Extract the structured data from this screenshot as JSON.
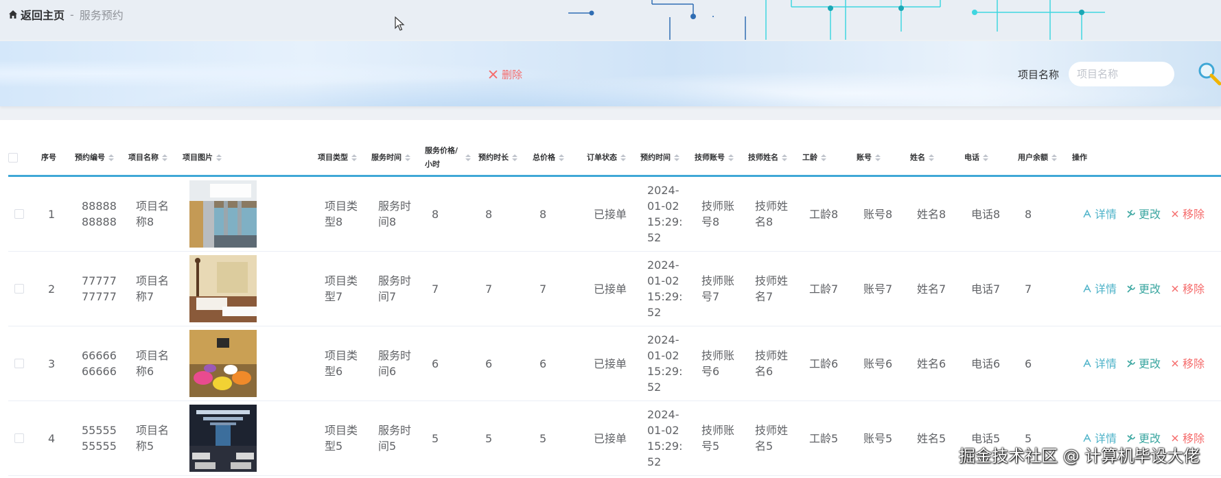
{
  "breadcrumb": {
    "home": "返回主页",
    "separator": "-",
    "current": "服务预约"
  },
  "toolbar": {
    "delete_label": "删除",
    "search_label": "项目名称",
    "search_placeholder": "项目名称",
    "search_value": ""
  },
  "table": {
    "columns": [
      "序号",
      "预约编号",
      "项目名称",
      "项目图片",
      "项目类型",
      "服务时间",
      "服务价格/小时",
      "预约时长",
      "总价格",
      "订单状态",
      "预约时间",
      "技师账号",
      "技师姓名",
      "工龄",
      "账号",
      "姓名",
      "电话",
      "用户余额",
      "操作"
    ],
    "rows": [
      {
        "index": "1",
        "booking_no": "8888888888",
        "project_name": "项目名称8",
        "project_type": "项目类型8",
        "service_time": "服务时间8",
        "price": "8",
        "duration": "8",
        "total": "8",
        "status": "已接单",
        "booking_time": "2024-01-02 15:29:52",
        "tech_account": "技师账号8",
        "tech_name": "技师姓名8",
        "seniority": "工龄8",
        "account": "账号8",
        "name": "姓名8",
        "phone": "电话8",
        "balance": "8"
      },
      {
        "index": "2",
        "booking_no": "7777777777",
        "project_name": "项目名称7",
        "project_type": "项目类型7",
        "service_time": "服务时间7",
        "price": "7",
        "duration": "7",
        "total": "7",
        "status": "已接单",
        "booking_time": "2024-01-02 15:29:52",
        "tech_account": "技师账号7",
        "tech_name": "技师姓名7",
        "seniority": "工龄7",
        "account": "账号7",
        "name": "姓名7",
        "phone": "电话7",
        "balance": "7"
      },
      {
        "index": "3",
        "booking_no": "6666666666",
        "project_name": "项目名称6",
        "project_type": "项目类型6",
        "service_time": "服务时间6",
        "price": "6",
        "duration": "6",
        "total": "6",
        "status": "已接单",
        "booking_time": "2024-01-02 15:29:52",
        "tech_account": "技师账号6",
        "tech_name": "技师姓名6",
        "seniority": "工龄6",
        "account": "账号6",
        "name": "姓名6",
        "phone": "电话6",
        "balance": "6"
      },
      {
        "index": "4",
        "booking_no": "5555555555",
        "project_name": "项目名称5",
        "project_type": "项目类型5",
        "service_time": "服务时间5",
        "price": "5",
        "duration": "5",
        "total": "5",
        "status": "已接单",
        "booking_time": "2024-01-02 15:29:52",
        "tech_account": "技师账号5",
        "tech_name": "技师姓名5",
        "seniority": "工龄5",
        "account": "账号5",
        "name": "姓名5",
        "phone": "电话5",
        "balance": "5"
      }
    ],
    "actions": {
      "detail": "详情",
      "edit": "更改",
      "remove": "移除"
    }
  },
  "watermark": "掘金技术社区 @ 计算机毕设大佬",
  "colors": {
    "accent_line": "#3fa7d6",
    "danger": "#f56c6c",
    "detail": "#4fb3c9",
    "edit": "#3aa6a0"
  }
}
